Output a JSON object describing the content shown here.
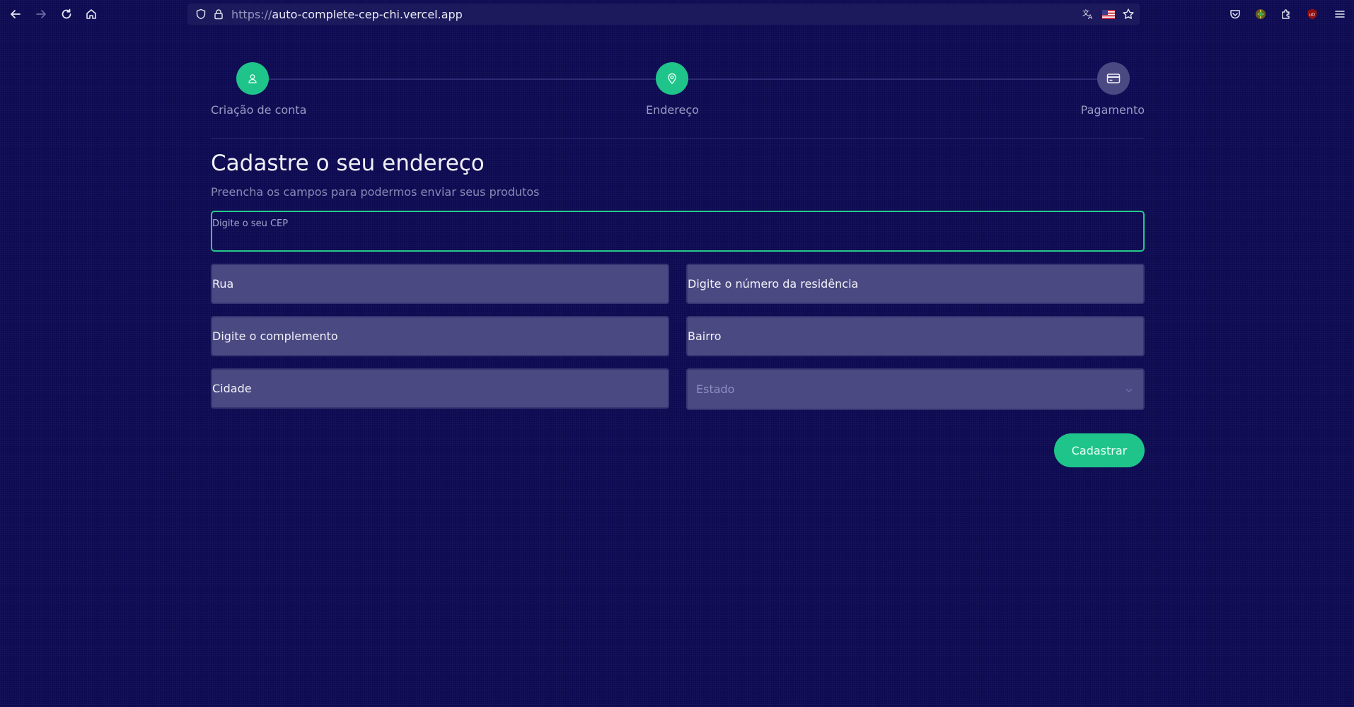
{
  "browser": {
    "url_scheme": "https://",
    "url_host": "auto-complete-cep-chi.vercel.app"
  },
  "stepper": {
    "steps": [
      {
        "label": "Criação de conta",
        "icon": "user-icon",
        "status": "done"
      },
      {
        "label": "Endereço",
        "icon": "map-pin-icon",
        "status": "active"
      },
      {
        "label": "Pagamento",
        "icon": "credit-card-icon",
        "status": "pending"
      }
    ]
  },
  "form": {
    "title": "Cadastre o seu endereço",
    "subtitle": "Preencha os campos para podermos enviar seus produtos",
    "cep_label": "Digite o seu CEP",
    "rua": "Rua",
    "numero": "Digite o número da residência",
    "complemento": "Digite o complemento",
    "bairro": "Bairro",
    "cidade": "Cidade",
    "estado_placeholder": "Estado",
    "submit_label": "Cadastrar"
  },
  "colors": {
    "background": "#0d0a52",
    "accent": "#1fc48a",
    "field_bg": "#4b4982",
    "pending_step": "#4b4982"
  }
}
